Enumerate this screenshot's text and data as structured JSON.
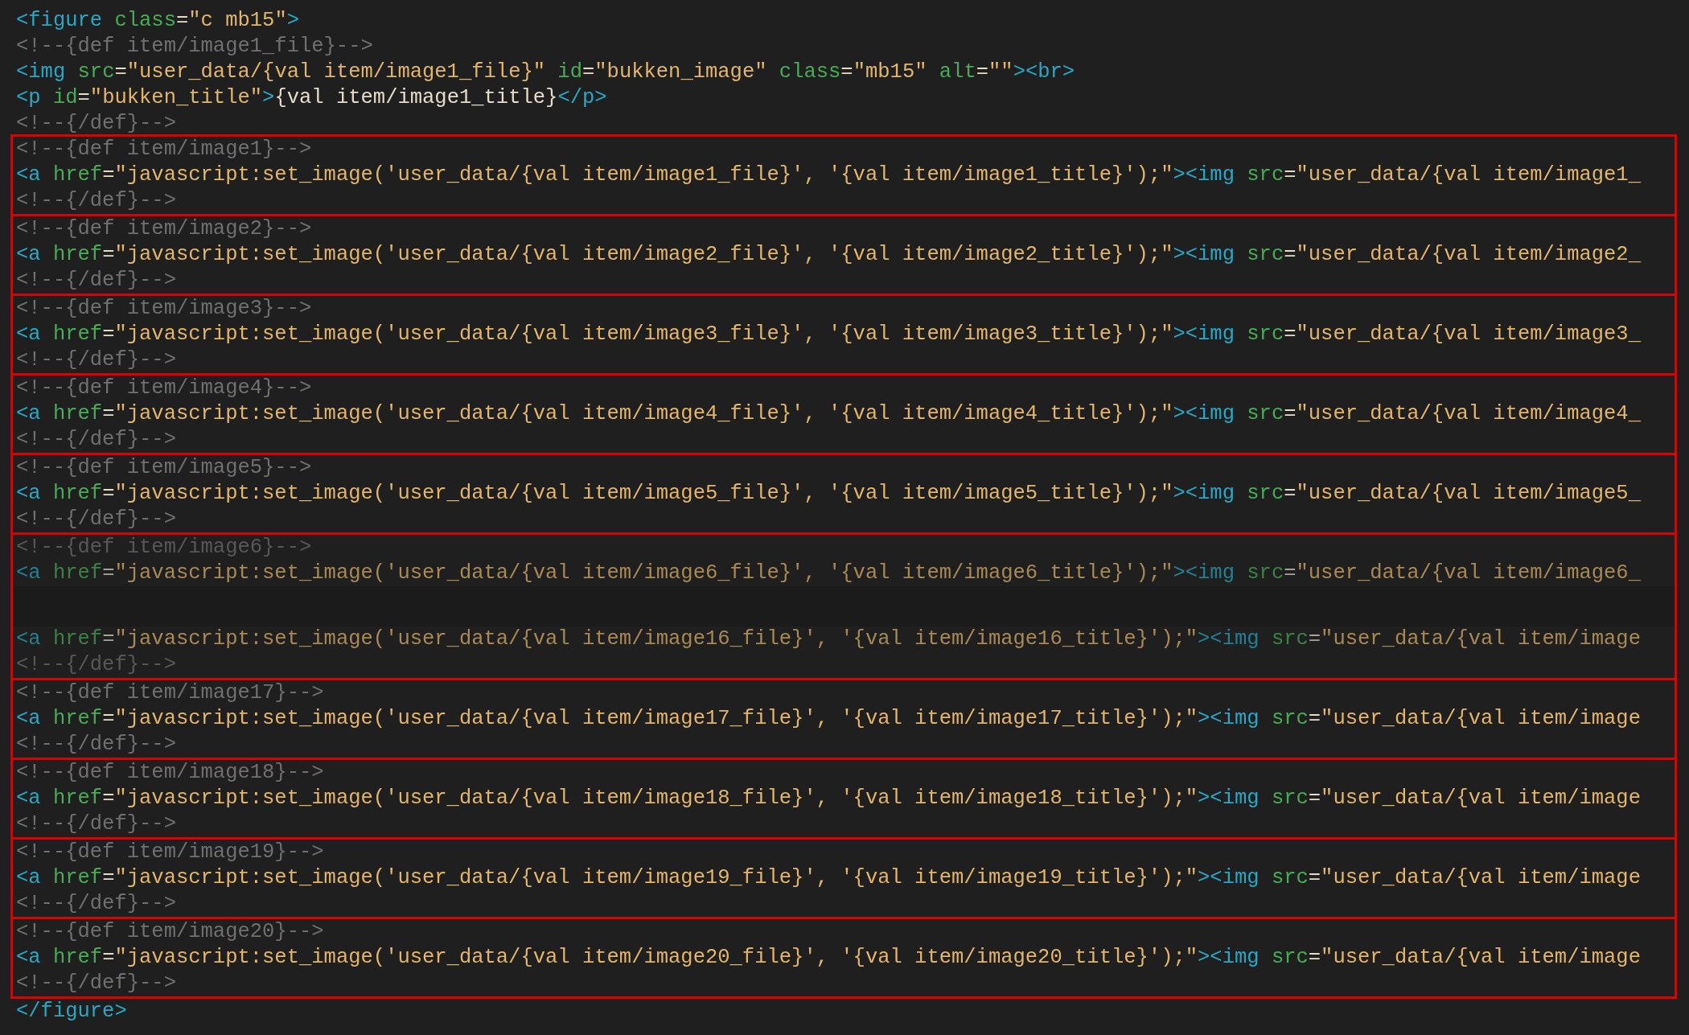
{
  "header_lines": [
    [
      {
        "kind": "tag",
        "text": "<figure"
      },
      {
        "kind": "attr",
        "text": " class"
      },
      {
        "kind": "plain",
        "text": "="
      },
      {
        "kind": "string",
        "text": "\"c mb15\""
      },
      {
        "kind": "tag",
        "text": ">"
      }
    ],
    [
      {
        "kind": "comment",
        "text": "<!--{def item/image1_file}-->"
      }
    ],
    [
      {
        "kind": "tag",
        "text": "<img"
      },
      {
        "kind": "attr",
        "text": " src"
      },
      {
        "kind": "plain",
        "text": "="
      },
      {
        "kind": "string",
        "text": "\"user_data/{val item/image1_file}\""
      },
      {
        "kind": "attr",
        "text": " id"
      },
      {
        "kind": "plain",
        "text": "="
      },
      {
        "kind": "string",
        "text": "\"bukken_image\""
      },
      {
        "kind": "attr",
        "text": " class"
      },
      {
        "kind": "plain",
        "text": "="
      },
      {
        "kind": "string",
        "text": "\"mb15\""
      },
      {
        "kind": "attr",
        "text": " alt"
      },
      {
        "kind": "plain",
        "text": "="
      },
      {
        "kind": "string",
        "text": "\"\""
      },
      {
        "kind": "tag",
        "text": "><br>"
      }
    ],
    [
      {
        "kind": "tag",
        "text": "<p"
      },
      {
        "kind": "attr",
        "text": " id"
      },
      {
        "kind": "plain",
        "text": "="
      },
      {
        "kind": "string",
        "text": "\"bukken_title\""
      },
      {
        "kind": "tag",
        "text": ">"
      },
      {
        "kind": "plain",
        "text": "{val item/image1_title}"
      },
      {
        "kind": "tag",
        "text": "</p>"
      }
    ],
    [
      {
        "kind": "comment",
        "text": "<!--{/def}-->"
      }
    ]
  ],
  "blocks": [
    {
      "lines": [
        {
          "kind": "code",
          "faded": false,
          "tokens": [
            {
              "kind": "comment",
              "text": "<!--{def item/image1}-->"
            }
          ]
        },
        {
          "kind": "code",
          "faded": false,
          "tokens": [
            {
              "kind": "tag",
              "text": "<a"
            },
            {
              "kind": "attr",
              "text": " href"
            },
            {
              "kind": "plain",
              "text": "="
            },
            {
              "kind": "string",
              "text": "\"javascript:set_image('user_data/{val item/image1_file}', '{val item/image1_title}');\""
            },
            {
              "kind": "tag",
              "text": "><img"
            },
            {
              "kind": "attr",
              "text": " src"
            },
            {
              "kind": "plain",
              "text": "="
            },
            {
              "kind": "string",
              "text": "\"user_data/{val item/image1_"
            }
          ]
        },
        {
          "kind": "code",
          "faded": false,
          "tokens": [
            {
              "kind": "comment",
              "text": "<!--{/def}-->"
            }
          ]
        }
      ]
    },
    {
      "lines": [
        {
          "kind": "code",
          "faded": false,
          "tokens": [
            {
              "kind": "comment",
              "text": "<!--{def item/image2}-->"
            }
          ]
        },
        {
          "kind": "code",
          "faded": false,
          "tokens": [
            {
              "kind": "tag",
              "text": "<a"
            },
            {
              "kind": "attr",
              "text": " href"
            },
            {
              "kind": "plain",
              "text": "="
            },
            {
              "kind": "string",
              "text": "\"javascript:set_image('user_data/{val item/image2_file}', '{val item/image2_title}');\""
            },
            {
              "kind": "tag",
              "text": "><img"
            },
            {
              "kind": "attr",
              "text": " src"
            },
            {
              "kind": "plain",
              "text": "="
            },
            {
              "kind": "string",
              "text": "\"user_data/{val item/image2_"
            }
          ]
        },
        {
          "kind": "code",
          "faded": false,
          "tokens": [
            {
              "kind": "comment",
              "text": "<!--{/def}-->"
            }
          ]
        }
      ]
    },
    {
      "lines": [
        {
          "kind": "code",
          "faded": false,
          "tokens": [
            {
              "kind": "comment",
              "text": "<!--{def item/image3}-->"
            }
          ]
        },
        {
          "kind": "code",
          "faded": false,
          "tokens": [
            {
              "kind": "tag",
              "text": "<a"
            },
            {
              "kind": "attr",
              "text": " href"
            },
            {
              "kind": "plain",
              "text": "="
            },
            {
              "kind": "string",
              "text": "\"javascript:set_image('user_data/{val item/image3_file}', '{val item/image3_title}');\""
            },
            {
              "kind": "tag",
              "text": "><img"
            },
            {
              "kind": "attr",
              "text": " src"
            },
            {
              "kind": "plain",
              "text": "="
            },
            {
              "kind": "string",
              "text": "\"user_data/{val item/image3_"
            }
          ]
        },
        {
          "kind": "code",
          "faded": false,
          "tokens": [
            {
              "kind": "comment",
              "text": "<!--{/def}-->"
            }
          ]
        }
      ]
    },
    {
      "lines": [
        {
          "kind": "code",
          "faded": false,
          "tokens": [
            {
              "kind": "comment",
              "text": "<!--{def item/image4}-->"
            }
          ]
        },
        {
          "kind": "code",
          "faded": false,
          "tokens": [
            {
              "kind": "tag",
              "text": "<a"
            },
            {
              "kind": "attr",
              "text": " href"
            },
            {
              "kind": "plain",
              "text": "="
            },
            {
              "kind": "string",
              "text": "\"javascript:set_image('user_data/{val item/image4_file}', '{val item/image4_title}');\""
            },
            {
              "kind": "tag",
              "text": "><img"
            },
            {
              "kind": "attr",
              "text": " src"
            },
            {
              "kind": "plain",
              "text": "="
            },
            {
              "kind": "string",
              "text": "\"user_data/{val item/image4_"
            }
          ]
        },
        {
          "kind": "code",
          "faded": false,
          "tokens": [
            {
              "kind": "comment",
              "text": "<!--{/def}-->"
            }
          ]
        }
      ]
    },
    {
      "lines": [
        {
          "kind": "code",
          "faded": false,
          "tokens": [
            {
              "kind": "comment",
              "text": "<!--{def item/image5}-->"
            }
          ]
        },
        {
          "kind": "code",
          "faded": false,
          "tokens": [
            {
              "kind": "tag",
              "text": "<a"
            },
            {
              "kind": "attr",
              "text": " href"
            },
            {
              "kind": "plain",
              "text": "="
            },
            {
              "kind": "string",
              "text": "\"javascript:set_image('user_data/{val item/image5_file}', '{val item/image5_title}');\""
            },
            {
              "kind": "tag",
              "text": "><img"
            },
            {
              "kind": "attr",
              "text": " src"
            },
            {
              "kind": "plain",
              "text": "="
            },
            {
              "kind": "string",
              "text": "\"user_data/{val item/image5_"
            }
          ]
        },
        {
          "kind": "code",
          "faded": false,
          "tokens": [
            {
              "kind": "comment",
              "text": "<!--{/def}-->"
            }
          ]
        }
      ]
    },
    {
      "lines": [
        {
          "kind": "code",
          "faded": true,
          "tokens": [
            {
              "kind": "comment",
              "text": "<!--{def item/image6}-->"
            }
          ]
        },
        {
          "kind": "code",
          "faded": true,
          "tokens": [
            {
              "kind": "tag",
              "text": "<a"
            },
            {
              "kind": "attr",
              "text": " href"
            },
            {
              "kind": "plain",
              "text": "="
            },
            {
              "kind": "string",
              "text": "\"javascript:set_image('user_data/{val item/image6_file}', '{val item/image6_title}');\""
            },
            {
              "kind": "tag",
              "text": "><img"
            },
            {
              "kind": "attr",
              "text": " src"
            },
            {
              "kind": "plain",
              "text": "="
            },
            {
              "kind": "string",
              "text": "\"user_data/{val item/image6_"
            }
          ]
        },
        {
          "kind": "gap"
        },
        {
          "kind": "code",
          "faded": true,
          "tokens": [
            {
              "kind": "tag",
              "text": "<a"
            },
            {
              "kind": "attr",
              "text": " href"
            },
            {
              "kind": "plain",
              "text": "="
            },
            {
              "kind": "string",
              "text": "\"javascript:set_image('user_data/{val item/image16_file}', '{val item/image16_title}');\""
            },
            {
              "kind": "tag",
              "text": "><img"
            },
            {
              "kind": "attr",
              "text": " src"
            },
            {
              "kind": "plain",
              "text": "="
            },
            {
              "kind": "string",
              "text": "\"user_data/{val item/image"
            }
          ]
        },
        {
          "kind": "code",
          "faded": true,
          "tokens": [
            {
              "kind": "comment",
              "text": "<!--{/def}-->"
            }
          ]
        }
      ]
    },
    {
      "lines": [
        {
          "kind": "code",
          "faded": false,
          "tokens": [
            {
              "kind": "comment",
              "text": "<!--{def item/image17}-->"
            }
          ]
        },
        {
          "kind": "code",
          "faded": false,
          "tokens": [
            {
              "kind": "tag",
              "text": "<a"
            },
            {
              "kind": "attr",
              "text": " href"
            },
            {
              "kind": "plain",
              "text": "="
            },
            {
              "kind": "string",
              "text": "\"javascript:set_image('user_data/{val item/image17_file}', '{val item/image17_title}');\""
            },
            {
              "kind": "tag",
              "text": "><img"
            },
            {
              "kind": "attr",
              "text": " src"
            },
            {
              "kind": "plain",
              "text": "="
            },
            {
              "kind": "string",
              "text": "\"user_data/{val item/image"
            }
          ]
        },
        {
          "kind": "code",
          "faded": false,
          "tokens": [
            {
              "kind": "comment",
              "text": "<!--{/def}-->"
            }
          ]
        }
      ]
    },
    {
      "lines": [
        {
          "kind": "code",
          "faded": false,
          "tokens": [
            {
              "kind": "comment",
              "text": "<!--{def item/image18}-->"
            }
          ]
        },
        {
          "kind": "code",
          "faded": false,
          "tokens": [
            {
              "kind": "tag",
              "text": "<a"
            },
            {
              "kind": "attr",
              "text": " href"
            },
            {
              "kind": "plain",
              "text": "="
            },
            {
              "kind": "string",
              "text": "\"javascript:set_image('user_data/{val item/image18_file}', '{val item/image18_title}');\""
            },
            {
              "kind": "tag",
              "text": "><img"
            },
            {
              "kind": "attr",
              "text": " src"
            },
            {
              "kind": "plain",
              "text": "="
            },
            {
              "kind": "string",
              "text": "\"user_data/{val item/image"
            }
          ]
        },
        {
          "kind": "code",
          "faded": false,
          "tokens": [
            {
              "kind": "comment",
              "text": "<!--{/def}-->"
            }
          ]
        }
      ]
    },
    {
      "lines": [
        {
          "kind": "code",
          "faded": false,
          "tokens": [
            {
              "kind": "comment",
              "text": "<!--{def item/image19}-->"
            }
          ]
        },
        {
          "kind": "code",
          "faded": false,
          "tokens": [
            {
              "kind": "tag",
              "text": "<a"
            },
            {
              "kind": "attr",
              "text": " href"
            },
            {
              "kind": "plain",
              "text": "="
            },
            {
              "kind": "string",
              "text": "\"javascript:set_image('user_data/{val item/image19_file}', '{val item/image19_title}');\""
            },
            {
              "kind": "tag",
              "text": "><img"
            },
            {
              "kind": "attr",
              "text": " src"
            },
            {
              "kind": "plain",
              "text": "="
            },
            {
              "kind": "string",
              "text": "\"user_data/{val item/image"
            }
          ]
        },
        {
          "kind": "code",
          "faded": false,
          "tokens": [
            {
              "kind": "comment",
              "text": "<!--{/def}-->"
            }
          ]
        }
      ]
    },
    {
      "lines": [
        {
          "kind": "code",
          "faded": false,
          "tokens": [
            {
              "kind": "comment",
              "text": "<!--{def item/image20}-->"
            }
          ]
        },
        {
          "kind": "code",
          "faded": false,
          "tokens": [
            {
              "kind": "tag",
              "text": "<a"
            },
            {
              "kind": "attr",
              "text": " href"
            },
            {
              "kind": "plain",
              "text": "="
            },
            {
              "kind": "string",
              "text": "\"javascript:set_image('user_data/{val item/image20_file}', '{val item/image20_title}');\""
            },
            {
              "kind": "tag",
              "text": "><img"
            },
            {
              "kind": "attr",
              "text": " src"
            },
            {
              "kind": "plain",
              "text": "="
            },
            {
              "kind": "string",
              "text": "\"user_data/{val item/image"
            }
          ]
        },
        {
          "kind": "code",
          "faded": false,
          "tokens": [
            {
              "kind": "comment",
              "text": "<!--{/def}-->"
            }
          ]
        }
      ]
    }
  ],
  "footer_lines": [
    [
      {
        "kind": "tag",
        "text": "</figure>"
      }
    ]
  ]
}
